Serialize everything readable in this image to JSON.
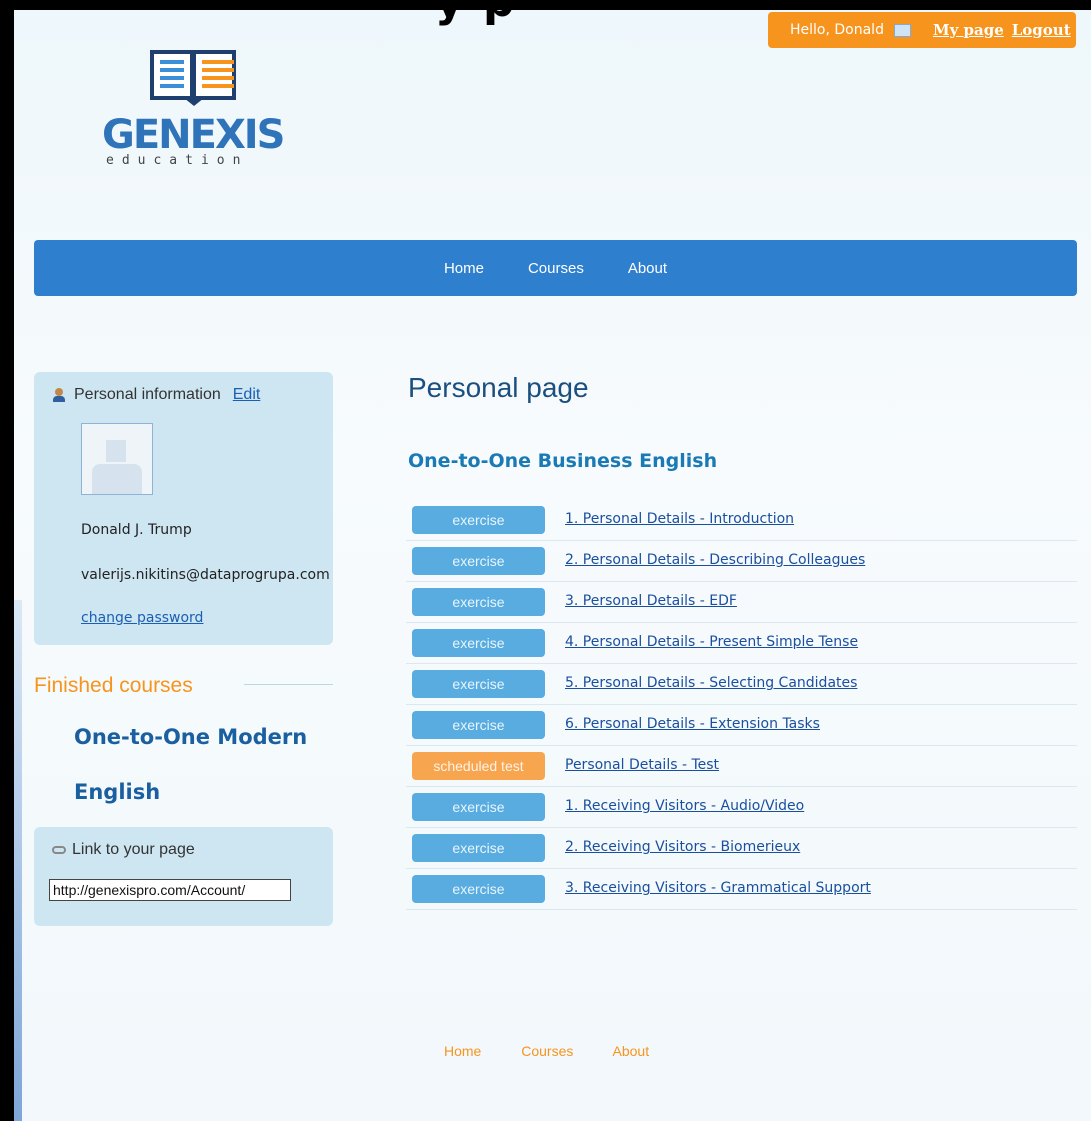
{
  "header": {
    "title_fragment": "y p",
    "greeting": "Hello, Donald",
    "my_page": "My page",
    "logout": "Logout"
  },
  "logo": {
    "brand": "GENEXIS",
    "tagline": "education"
  },
  "nav": {
    "items": [
      "Home",
      "Courses",
      "About"
    ]
  },
  "sidebar": {
    "personal_info": {
      "heading": "Personal information",
      "edit": "Edit",
      "name": "Donald J. Trump",
      "email": "valerijs.nikitins@dataprogrupa.com",
      "change_password": "change password"
    },
    "finished": {
      "heading": "Finished courses",
      "course_line1": "One-to-One Modern",
      "course_line2": "English"
    },
    "link": {
      "heading": "Link to your page",
      "value": "http://genexispro.com/Account/"
    }
  },
  "main": {
    "title": "Personal page",
    "course": "One-to-One Business English",
    "exercises": [
      {
        "type": "exercise",
        "title": "1. Personal Details - Introduction"
      },
      {
        "type": "exercise",
        "title": "2. Personal Details - Describing Colleagues"
      },
      {
        "type": "exercise",
        "title": "3. Personal Details - EDF"
      },
      {
        "type": "exercise",
        "title": "4. Personal Details - Present Simple Tense"
      },
      {
        "type": "exercise",
        "title": "5. Personal Details - Selecting Candidates"
      },
      {
        "type": "exercise",
        "title": "6. Personal Details - Extension Tasks"
      },
      {
        "type": "scheduled test",
        "title": "Personal Details - Test"
      },
      {
        "type": "exercise",
        "title": "1. Receiving Visitors - Audio/Video"
      },
      {
        "type": "exercise",
        "title": "2. Receiving Visitors - Biomerieux"
      },
      {
        "type": "exercise",
        "title": "3. Receiving Visitors - Grammatical Support"
      }
    ]
  },
  "footer": {
    "items": [
      "Home",
      "Courses",
      "About"
    ]
  },
  "colors": {
    "accent_orange": "#f7941d",
    "nav_blue": "#2f7fcf",
    "badge_blue": "#58ace0",
    "badge_orange": "#f7a54f"
  }
}
